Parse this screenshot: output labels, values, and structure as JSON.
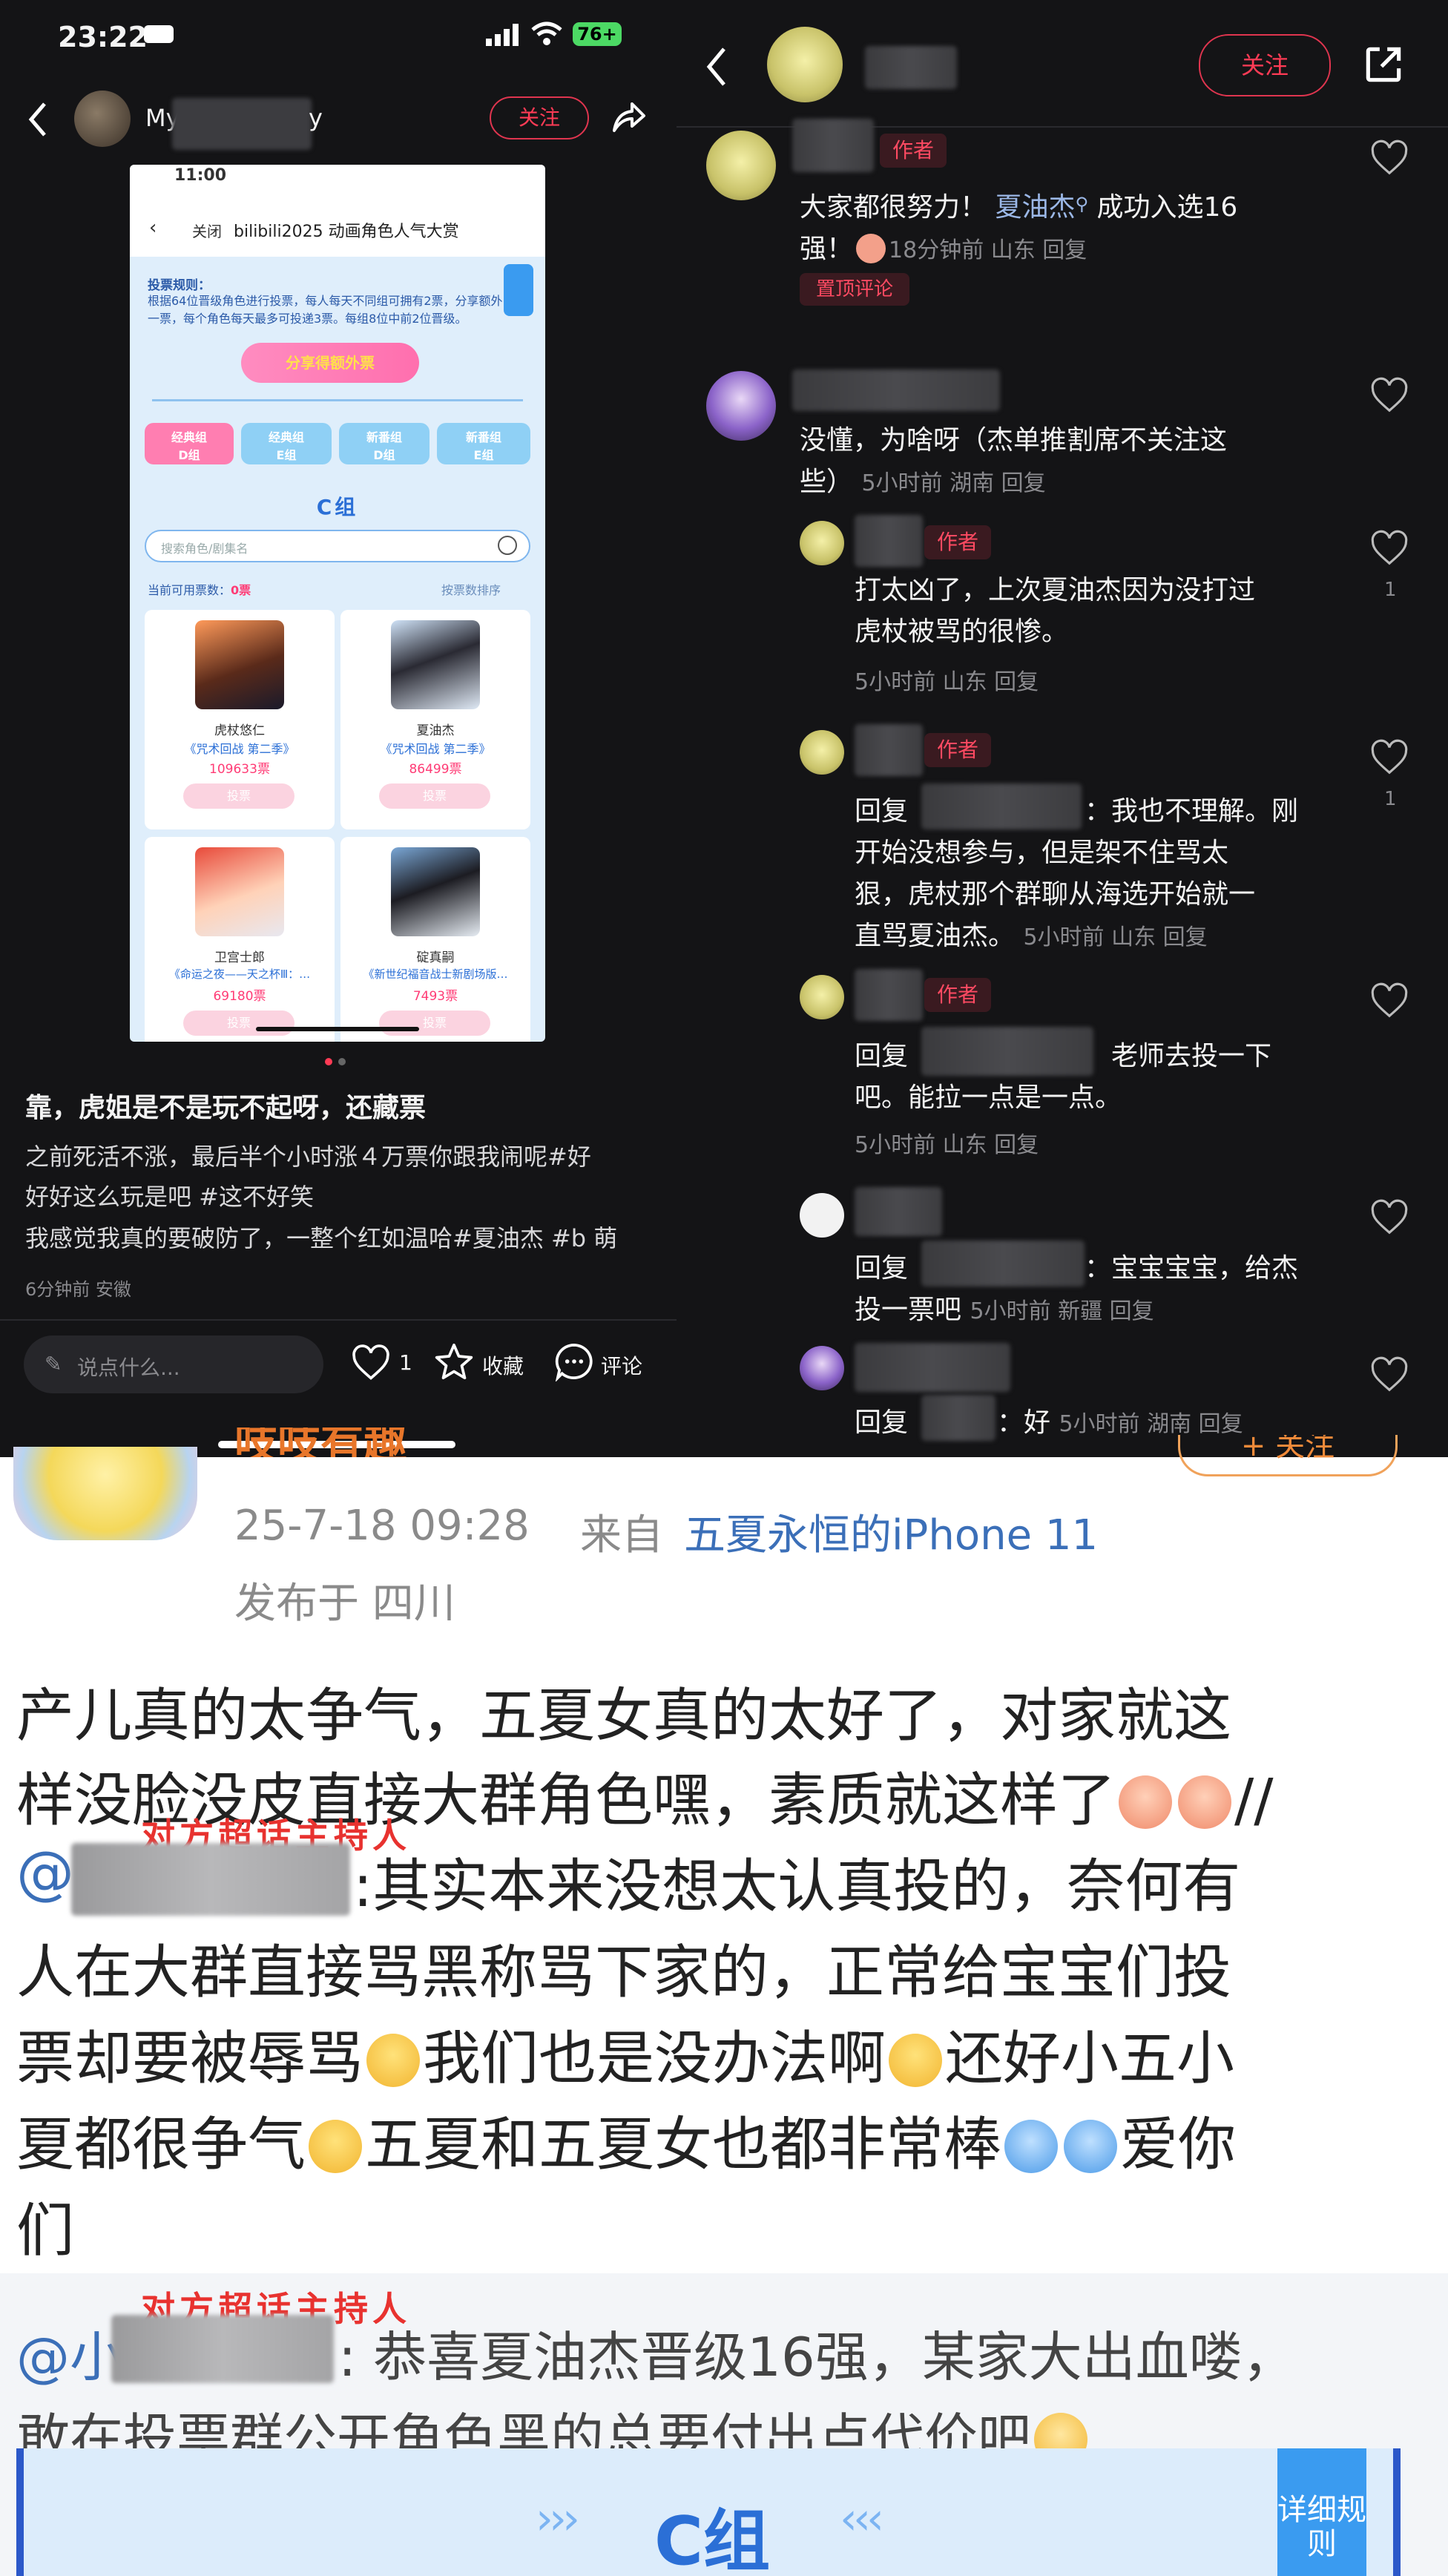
{
  "status_bar": {
    "time": "23:22",
    "battery": "76+"
  },
  "left_post": {
    "username_prefix": "My",
    "username_suffix": "y",
    "follow_label": "关注",
    "title": "靠，虎姐是不是玩不起呀，还藏票",
    "body_lines": [
      "之前死活不涨，最后半个小时涨４万票你跟我闹呢#好",
      "好好这么玩是吧 #这不好笑",
      "我感觉我真的要破防了，一整个红如温哈#夏油杰 #b 萌"
    ],
    "meta": "6分钟前 安徽",
    "comment_placeholder": "说点什么...",
    "like_count": "1",
    "collect_label": "收藏",
    "comment_label": "评论"
  },
  "phone": {
    "time": "11:00",
    "close_label": "关闭",
    "header_title": "bilibili2025 动画角色人气大赏",
    "rules_title": "投票规则：",
    "rules_text": "根据64位晋级角色进行投票，每人每天不同组可拥有2票，分享额外一票，每个角色每天最多可投递3票。每组8位中前2位晋级。",
    "share_btn": "分享得额外票",
    "tabs": [
      "经典组",
      "经典组",
      "新番组",
      "新番组"
    ],
    "tab_sub": [
      "D组",
      "E组",
      "D组",
      "E组"
    ],
    "group_label": "C组",
    "search_placeholder": "搜索角色/剧集名",
    "current_votes_label": "当前可用票数：",
    "current_votes_value": "0票",
    "sort_label": "按票数排序",
    "vote_label": "投票",
    "characters": [
      {
        "name": "虎杖悠仁",
        "work": "《咒术回战 第二季》",
        "votes": "109633票"
      },
      {
        "name": "夏油杰",
        "work": "《咒术回战 第二季》",
        "votes": "86499票"
      },
      {
        "name": "卫宫士郎",
        "work": "《命运之夜——天之杯Ⅲ：…",
        "votes": "69180票"
      },
      {
        "name": "碇真嗣",
        "work": "《新世纪福音战士新剧场版…",
        "votes": "7493票"
      }
    ]
  },
  "right_thread": {
    "follow_label": "关注",
    "author_tag": "作者",
    "pinned_tag": "置顶评论",
    "comments": [
      {
        "text_a": "大家都很努力！ ",
        "link": "夏油杰",
        "text_b": " 成功入选16",
        "line2": "强！",
        "meta": "18分钟前 山东 回复"
      },
      {
        "line1": "没懂，为啥呀（杰单推割席不关注这",
        "line2": "些）",
        "meta": "5小时前 湖南 回复"
      },
      {
        "line1": "打太凶了，上次夏油杰因为没打过",
        "line2": "虎杖被骂的很惨。",
        "meta": "5小时前 山东 回复",
        "likes": "1"
      },
      {
        "prefix": "回复",
        "line1": "：我也不理解。刚",
        "line2": "开始没想参与，但是架不住骂太",
        "line3": "狠，虎杖那个群聊从海选开始就一",
        "line4": "直骂夏油杰。",
        "meta": "5小时前 山东 回复",
        "likes": "1"
      },
      {
        "prefix": "回复",
        "line1": " 老师去投一下",
        "line2": "吧。能拉一点是一点。",
        "meta": "5小时前 山东 回复"
      },
      {
        "prefix": "回复",
        "line1": "：宝宝宝宝，给杰",
        "line2": "投一票吧",
        "meta": "5小时前 新疆 回复"
      },
      {
        "prefix": "回复",
        "line1": "：好",
        "meta": "5小时前 湖南 回复"
      }
    ]
  },
  "weibo": {
    "partial_name": "吱吱有趣",
    "follow_partial": "+ 关注",
    "date": "25-7-18 09:28",
    "from_label": "来自",
    "device": "五夏永恒的iPhone 11",
    "location": "发布于 四川",
    "host_label": "对方超话主持人",
    "main_lines": [
      "产儿真的太争气，五夏女真的太好了，对家就这",
      "样没脸没皮直接大群角色嘿，素质就这样了",
      ":其实本来没想太认真投的，奈何有",
      "人在大群直接骂黑称骂下家的，正常给宝宝们投",
      "票却要被辱骂",
      "我们也是没办法啊",
      "还好小五小",
      "夏都很争气",
      "五夏和五夏女也都非常棒",
      "爱你",
      "们"
    ],
    "slashes": "//",
    "at": "@",
    "quote_prefix": "@小",
    "quote_line1": ": 恭喜夏油杰晋级16强，某家大出血喽，",
    "quote_line2": "敢在投票群公开角色黑的总要付出点代价吧",
    "banner_label": "C组",
    "banner_side": "详细规则"
  }
}
